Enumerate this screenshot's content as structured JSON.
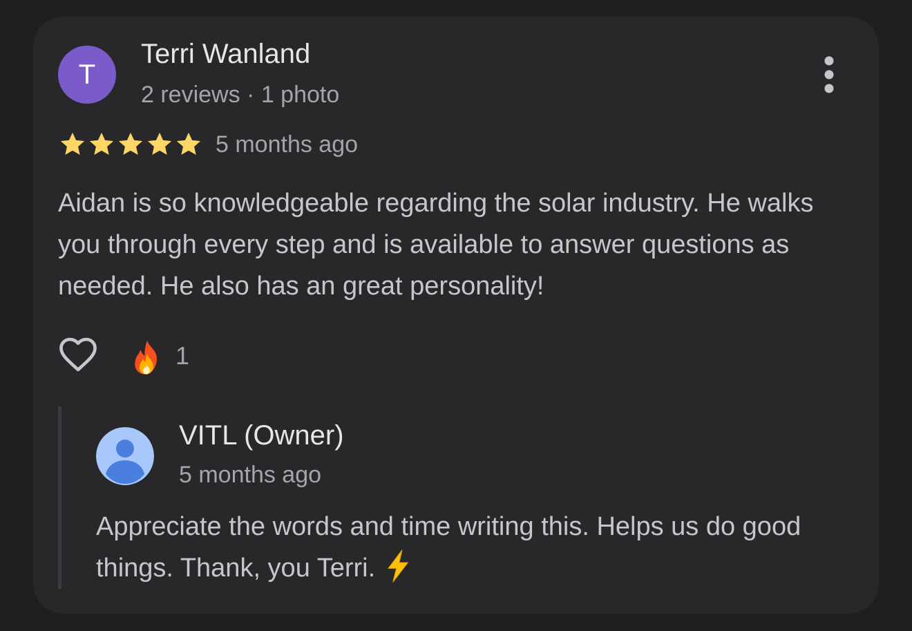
{
  "review": {
    "avatar_letter": "T",
    "avatar_color": "#7b5bc9",
    "author_name": "Terri Wanland",
    "author_meta": "2 reviews · 1 photo",
    "rating": 5,
    "rating_max": 5,
    "star_color": "#fdd663",
    "time": "5 months ago",
    "text": "Aidan is so knowledgeable regarding the solar industry. He walks you through every step and is available to answer questions as needed. He also has an great personality!",
    "more_icon": "more-vert-icon",
    "like_icon": "heart-outline-icon",
    "reaction_icon": "fire-emoji-icon",
    "reaction_count": "1"
  },
  "reply": {
    "owner_name": "VITL (Owner)",
    "time": "5 months ago",
    "avatar_icon": "default-profile-icon",
    "text": "Appreciate the words and time writing this. Helps us do good things. Thank, you Terri.",
    "trailing_icon": "lightning-emoji-icon"
  }
}
